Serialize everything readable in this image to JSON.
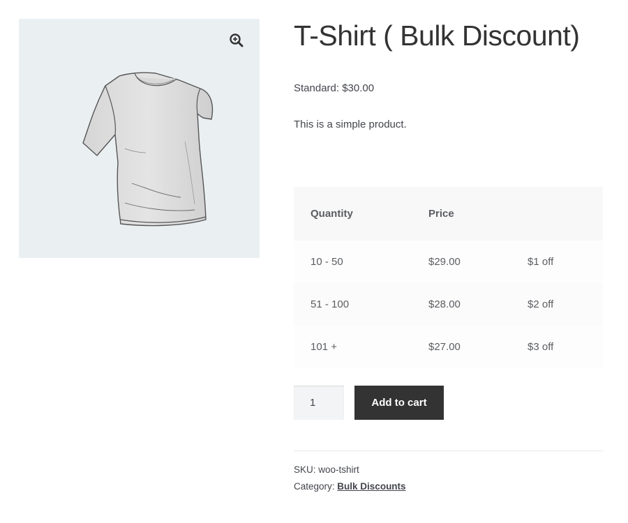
{
  "product": {
    "title": "T-Shirt ( Bulk Discount)",
    "price_label": "Standard: $30.00",
    "description": "This is a simple product."
  },
  "gallery": {
    "zoom_icon": "zoom-in-icon",
    "image": "t-shirt"
  },
  "discount_table": {
    "headers": [
      "Quantity",
      "Price",
      ""
    ],
    "rows": [
      [
        "10 - 50",
        "$29.00",
        "$1 off"
      ],
      [
        "51 - 100",
        "$28.00",
        "$2 off"
      ],
      [
        "101 +",
        "$27.00",
        "$3 off"
      ]
    ]
  },
  "cart": {
    "quantity": "1",
    "add_to_cart_label": "Add to cart"
  },
  "meta": {
    "sku_label": "SKU:",
    "sku_value": "woo-tshirt",
    "category_label": "Category:",
    "category_value": "Bulk Discounts"
  },
  "colors": {
    "gallery_bg": "#eaeff2",
    "button_bg": "#333333",
    "text": "#43454b"
  }
}
